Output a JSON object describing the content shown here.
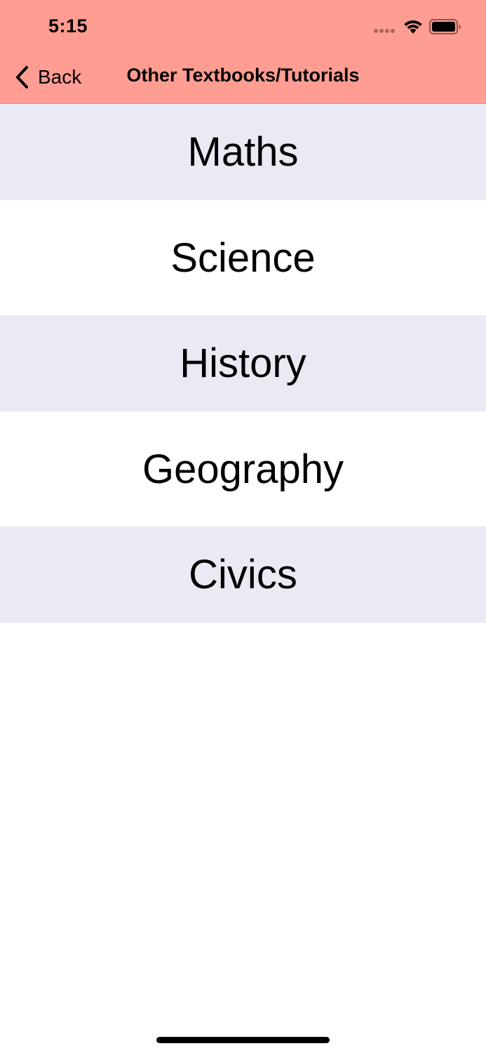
{
  "status_bar": {
    "time": "5:15"
  },
  "nav": {
    "back_label": "Back",
    "title": "Other Textbooks/Tutorials",
    "background_color": "#ff9d92"
  },
  "list": {
    "items": [
      {
        "label": "Maths"
      },
      {
        "label": "Science"
      },
      {
        "label": "History"
      },
      {
        "label": "Geography"
      },
      {
        "label": "Civics"
      }
    ],
    "shaded_row_color": "#eaeaf5"
  }
}
